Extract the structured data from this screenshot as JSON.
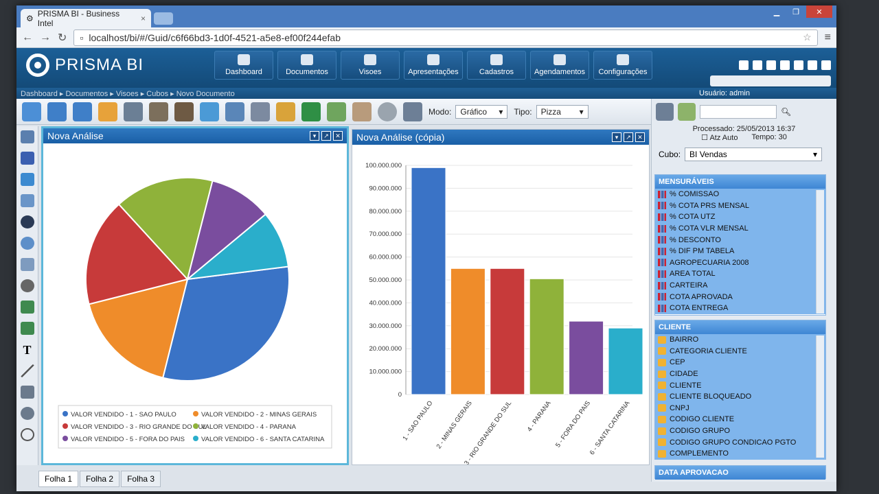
{
  "browser": {
    "tab_title": "PRISMA BI - Business Intel",
    "url": "localhost/bi/#/Guid/c6f66bd3-1d0f-4521-a5e8-ef00f244efab"
  },
  "app": {
    "brand": "PRISMA BI",
    "user": "Usuário: admin"
  },
  "nav": [
    {
      "label": "Dashboard"
    },
    {
      "label": "Documentos"
    },
    {
      "label": "Visoes"
    },
    {
      "label": "Apresentações"
    },
    {
      "label": "Cadastros"
    },
    {
      "label": "Agendamentos"
    },
    {
      "label": "Configurações"
    }
  ],
  "breadcrumb": "Dashboard ▸ Documentos ▸ Visoes ▸ Cubos ▸ Novo Documento",
  "toolbar": {
    "modo_label": "Modo:",
    "modo_value": "Gráfico",
    "tipo_label": "Tipo:",
    "tipo_value": "Pizza"
  },
  "panels": {
    "left_title": "Nova Análise",
    "right_title": "Nova Análise (cópia)"
  },
  "sheets": [
    "Folha 1",
    "Folha 2",
    "Folha 3"
  ],
  "right": {
    "processed": "Processado: 25/05/2013 16:37",
    "auto": "Atz Auto",
    "tempo": "Tempo: 30",
    "cubo_label": "Cubo:",
    "cubo_value": "BI Vendas",
    "mensuraveis_title": "MENSURÁVEIS",
    "mensuraveis": [
      "% COMISSAO",
      "% COTA PRS MENSAL",
      "% COTA UTZ",
      "% COTA VLR MENSAL",
      "% DESCONTO",
      "% DIF PM TABELA",
      "AGROPECUARIA 2008",
      "AREA TOTAL",
      "CARTEIRA",
      "COTA APROVADA",
      "COTA ENTREGA"
    ],
    "cliente_title": "CLIENTE",
    "cliente": [
      "BAIRRO",
      "CATEGORIA CLIENTE",
      "CEP",
      "CIDADE",
      "CLIENTE",
      "CLIENTE BLOQUEADO",
      "CNPJ",
      "CODIGO CLIENTE",
      "CODIGO GRUPO",
      "CODIGO GRUPO CONDICAO PGTO",
      "COMPLEMENTO"
    ],
    "data_title": "DATA APROVACAO"
  },
  "chart_data": [
    {
      "type": "pie",
      "labels": [
        "VALOR VENDIDO - 1 - SAO PAULO",
        "VALOR VENDIDO - 2 - MINAS GERAIS",
        "VALOR VENDIDO - 3 - RIO GRANDE DO SUL",
        "VALOR VENDIDO - 4 - PARANA",
        "VALOR VENDIDO - 5 - FORA DO PAIS",
        "VALOR VENDIDO - 6 - SANTA CATARINA"
      ],
      "values": [
        99000000,
        55000000,
        55000000,
        50500000,
        32000000,
        29000000
      ],
      "colors": [
        "#3a73c6",
        "#ef8c2a",
        "#c73a3a",
        "#8fb23a",
        "#7a4d9e",
        "#2aaecb"
      ]
    },
    {
      "type": "bar",
      "categories": [
        "1 - SAO PAULO",
        "2 - MINAS GERAIS",
        "3 - RIO GRANDE DO SUL",
        "4 - PARANA",
        "5 - FORA DO PAIS",
        "6 - SANTA CATARINA"
      ],
      "values": [
        99000000,
        55000000,
        55000000,
        50500000,
        32000000,
        29000000
      ],
      "ylim": [
        0,
        100000000
      ],
      "yticks": [
        "0",
        "10.000.000",
        "20.000.000",
        "30.000.000",
        "40.000.000",
        "50.000.000",
        "60.000.000",
        "70.000.000",
        "80.000.000",
        "90.000.000",
        "100.000.000"
      ],
      "colors": [
        "#3a73c6",
        "#ef8c2a",
        "#c73a3a",
        "#8fb23a",
        "#7a4d9e",
        "#2aaecb"
      ]
    }
  ]
}
